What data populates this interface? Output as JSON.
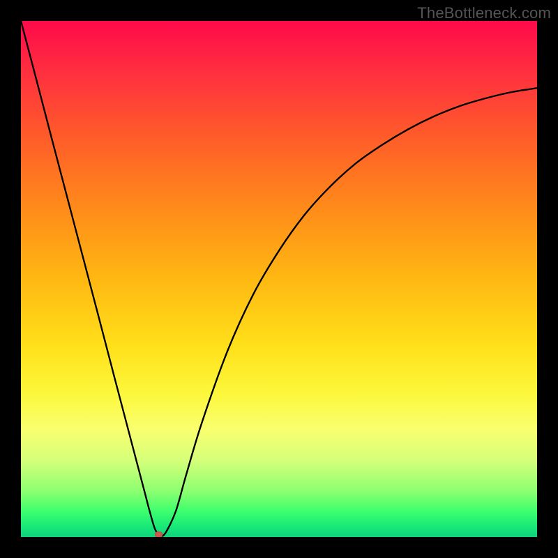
{
  "watermark": "TheBottleneck.com",
  "chart_data": {
    "type": "line",
    "title": "",
    "xlabel": "",
    "ylabel": "",
    "xlim": [
      0,
      100
    ],
    "ylim": [
      0,
      100
    ],
    "grid": false,
    "legend": false,
    "background": "rainbow-gradient (red top → green bottom)",
    "series": [
      {
        "name": "curve",
        "x": [
          0,
          3,
          6,
          9,
          12,
          15,
          18,
          20,
          22,
          24,
          25,
          26,
          27,
          28,
          30,
          32,
          35,
          40,
          45,
          50,
          55,
          60,
          65,
          70,
          75,
          80,
          85,
          90,
          95,
          100
        ],
        "y": [
          100,
          88.6,
          77.1,
          65.7,
          54.3,
          42.9,
          31.4,
          23.8,
          16.2,
          8.6,
          4.8,
          1.5,
          0.3,
          0.8,
          5.0,
          12.0,
          22.0,
          36.0,
          47.0,
          55.5,
          62.5,
          68.0,
          72.5,
          76.0,
          79.0,
          81.5,
          83.5,
          85.0,
          86.2,
          87.0
        ]
      }
    ],
    "marker": {
      "x": 26.7,
      "y": 0.5,
      "color": "#c85a4a"
    }
  },
  "colors": {
    "gradient_top": "#ff0a4a",
    "gradient_bottom": "#0ed47c",
    "curve": "#000000",
    "frame": "#000000",
    "marker": "#c85a4a"
  }
}
